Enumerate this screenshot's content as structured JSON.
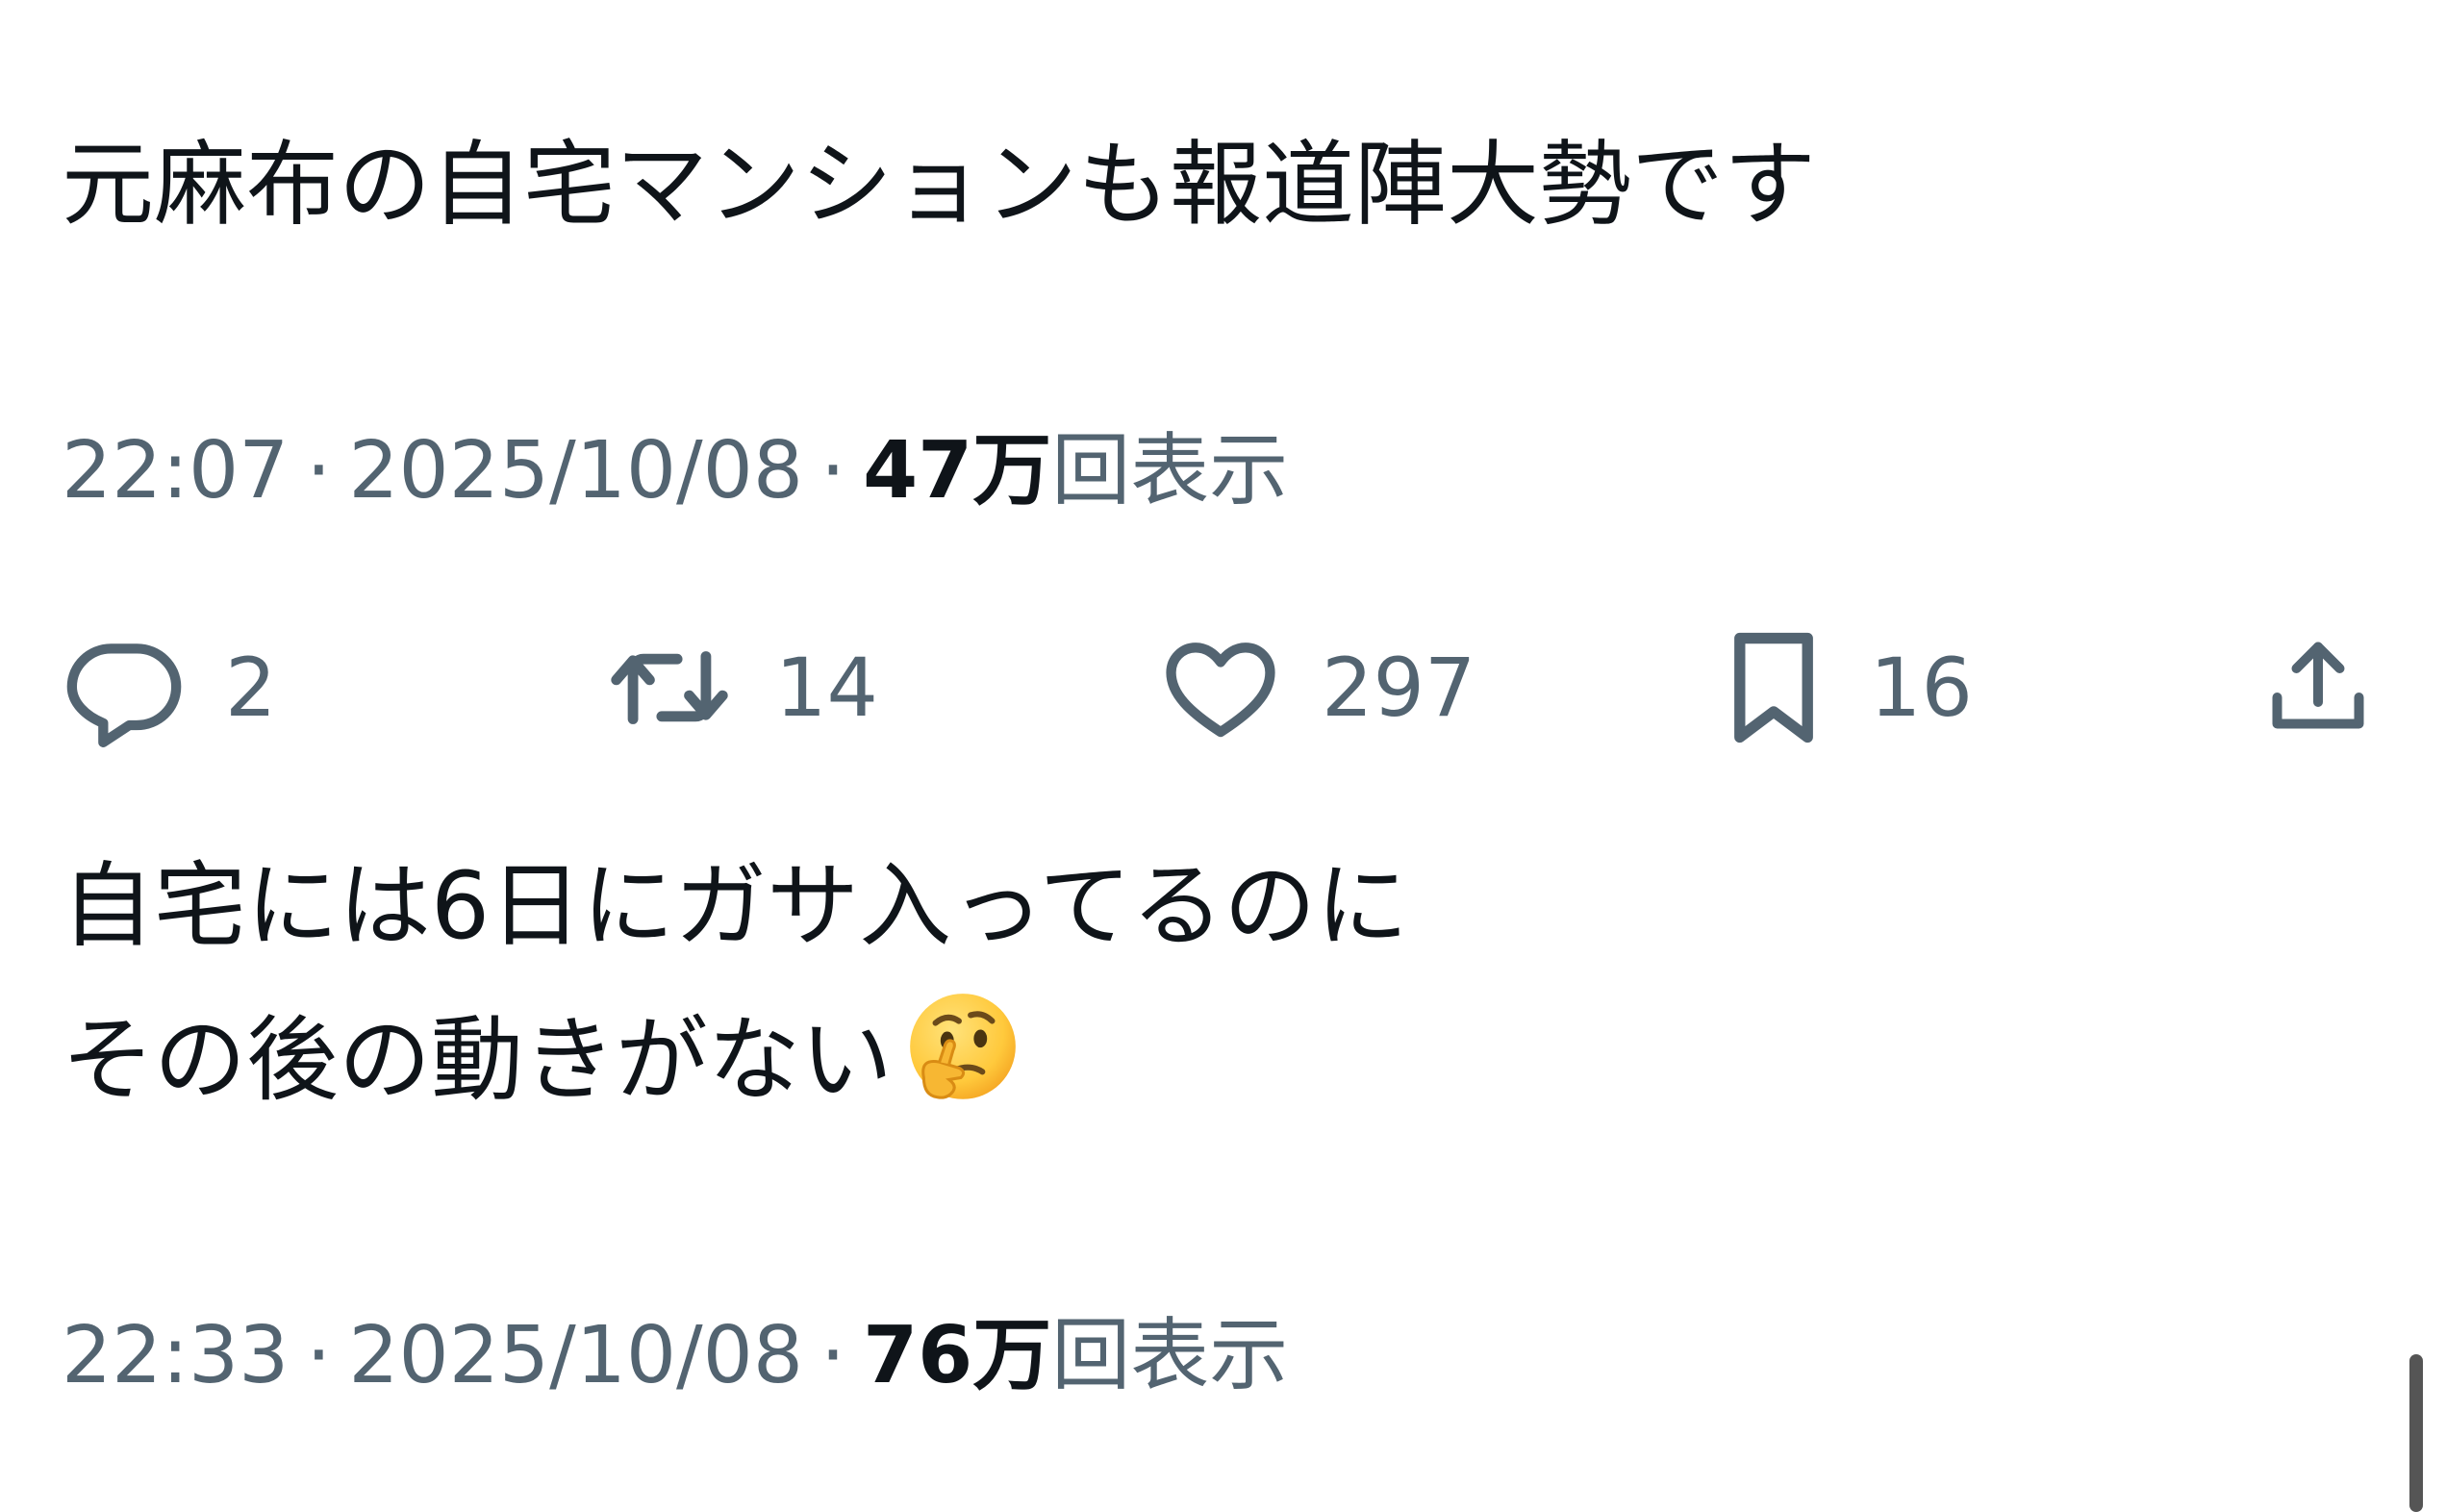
{
  "tweets": [
    {
      "text_lines": [
        "元麻布の自宅マンションも報道陣大勢です"
      ],
      "time": "22:07",
      "date": "2025/10/08",
      "views_count": "47万",
      "views_label": "回表示",
      "separator": "·"
    },
    {
      "text_lines": [
        "自宅には6日にガサ入ってるのに",
        "その後の動きがない"
      ],
      "emoji": "thinking-face",
      "time": "22:33",
      "date": "2025/10/08",
      "views_count": "76万",
      "views_label": "回表示",
      "separator": "·"
    }
  ],
  "actions": {
    "reply": {
      "icon": "reply-icon",
      "count": "2"
    },
    "repost": {
      "icon": "repost-icon",
      "count": "14"
    },
    "like": {
      "icon": "heart-icon",
      "count": "297"
    },
    "bookmark": {
      "icon": "bookmark-icon",
      "count": "16"
    },
    "share": {
      "icon": "share-icon"
    }
  },
  "colors": {
    "text": "#0f1419",
    "secondary": "#536471",
    "background": "#ffffff"
  }
}
